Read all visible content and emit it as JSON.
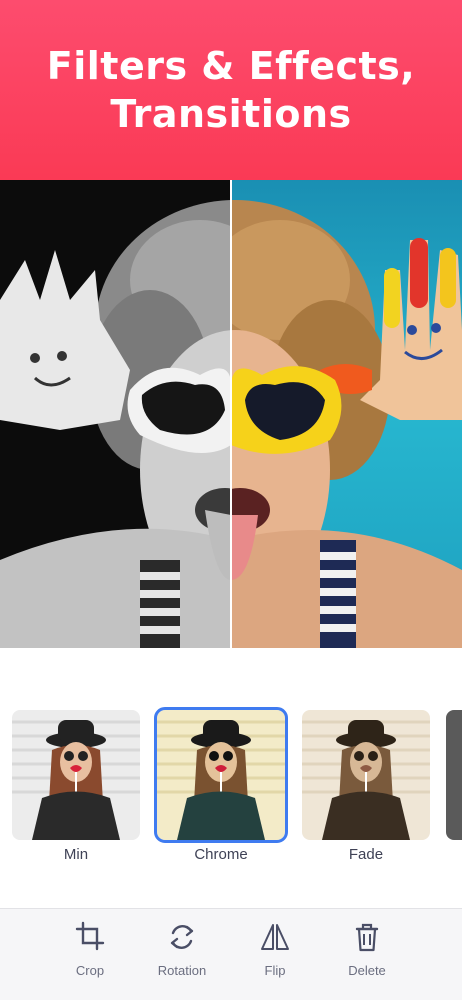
{
  "banner": {
    "title_line1": "Filters & Effects,",
    "title_line2": "Transitions",
    "color": "#fa3a55"
  },
  "preview": {
    "left_effect": "grayscale",
    "right_effect": "original color"
  },
  "filters": {
    "selected": "Chrome",
    "selected_color": "#3f7bf0",
    "items": [
      {
        "label": "Min"
      },
      {
        "label": "Chrome"
      },
      {
        "label": "Fade"
      }
    ]
  },
  "toolbar": {
    "items": [
      {
        "label": "Crop",
        "icon": "crop-icon"
      },
      {
        "label": "Rotation",
        "icon": "rotation-icon"
      },
      {
        "label": "Flip",
        "icon": "flip-icon"
      },
      {
        "label": "Delete",
        "icon": "trash-icon"
      }
    ]
  }
}
